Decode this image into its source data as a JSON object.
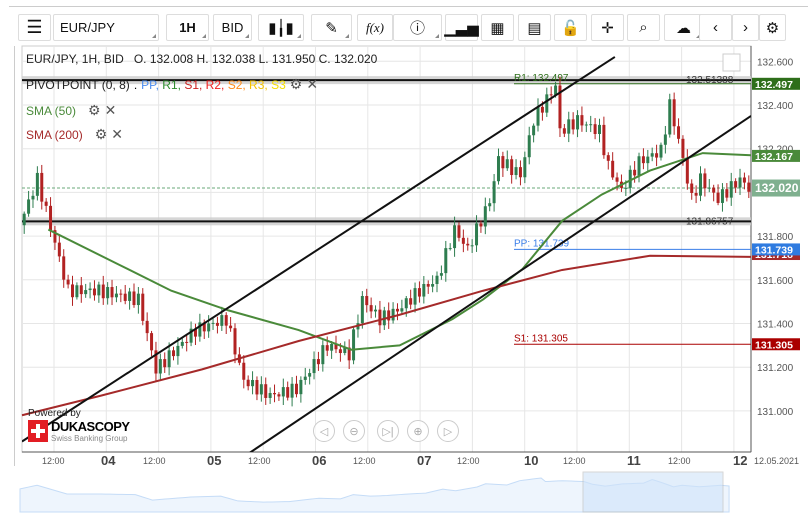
{
  "toolbar": {
    "menu_icon": "hamburger-icon",
    "instrument": "EUR/JPY",
    "timeframe": "1H",
    "side": "BID",
    "fx_label": "f(x)",
    "icons": [
      "candlestick-icon",
      "pencil-icon",
      "function-icon",
      "info-icon",
      "volume-bars-icon",
      "calendar-icon",
      "report-icon",
      "lock-open-icon",
      "crosshair-icon",
      "zoom-search-icon",
      "cloud-upload-icon",
      "chevron-left-icon",
      "chevron-right-icon",
      "gear-icon"
    ]
  },
  "header": {
    "ohlc": "EUR/JPY, 1H, BID   O. 132.008 H. 132.038 L. 131.950 C. 132.020"
  },
  "legend": {
    "pivot": "PIVOTPOINT (0, 8)",
    "pivot_sep": " . ",
    "pivot_items": [
      {
        "t": "PP",
        "c": "#4a8cf0"
      },
      {
        "t": "R1",
        "c": "#2e8b2e"
      },
      {
        "t": "S1",
        "c": "#cc2222"
      },
      {
        "t": "R2",
        "c": "#ee2222"
      },
      {
        "t": "S2",
        "c": "#ff8c1a"
      },
      {
        "t": "R3",
        "c": "#f2c200"
      },
      {
        "t": "S3",
        "c": "#f5e000"
      }
    ],
    "sma50": "SMA (50)",
    "sma200": "SMA (200)"
  },
  "levels": {
    "r1_label": "R1: 132.497",
    "r1_value": "132.497",
    "pp_label": "PP: 131.739",
    "pp_value": "131.739",
    "s1_label": "S1: 131.305",
    "s1_value": "131.305",
    "hline_top_label": "132.51388",
    "hline_bot_label": "131.86757",
    "sma50_value": "132.167",
    "sma200_value": "131.718",
    "current_value": "132.020"
  },
  "colors": {
    "up": "#2e7d4f",
    "down": "#b22222",
    "sma50": "#4a8a3a",
    "sma200": "#a52a2a",
    "r1": "#2e6e1a",
    "pp": "#3a7ee8",
    "s1": "#aa0000",
    "current": "#6aa87a"
  },
  "price_axis": [
    "132.600",
    "132.400",
    "132.200",
    "131.800",
    "131.600",
    "131.400",
    "131.200",
    "131.000"
  ],
  "time_axis": {
    "hours": [
      "12:00",
      "12:00",
      "12:00",
      "12:00",
      "12:00",
      "12:00",
      "12:00"
    ],
    "days": [
      "04",
      "05",
      "06",
      "07",
      "10",
      "11",
      "12"
    ],
    "date": "12.05.2021"
  },
  "brand": {
    "powered": "Powered by",
    "name": "DUKASCOPY",
    "sub": "Swiss Banking Group"
  },
  "chart_data": {
    "type": "candlestick",
    "ylim": [
      130.92,
      132.72
    ],
    "hours": 166,
    "price_anchors": [
      [
        0,
        131.85
      ],
      [
        4,
        132.06
      ],
      [
        11,
        131.55
      ],
      [
        18,
        131.55
      ],
      [
        27,
        131.51
      ],
      [
        31,
        131.19
      ],
      [
        40,
        131.37
      ],
      [
        47,
        131.42
      ],
      [
        51,
        131.14
      ],
      [
        57,
        131.07
      ],
      [
        63,
        131.1
      ],
      [
        70,
        131.3
      ],
      [
        75,
        131.26
      ],
      [
        78,
        131.51
      ],
      [
        82,
        131.42
      ],
      [
        86,
        131.46
      ],
      [
        91,
        131.55
      ],
      [
        95,
        131.6
      ],
      [
        99,
        131.83
      ],
      [
        102,
        131.74
      ],
      [
        107,
        131.96
      ],
      [
        109,
        132.15
      ],
      [
        114,
        132.08
      ],
      [
        117,
        132.33
      ],
      [
        122,
        132.49
      ],
      [
        123,
        132.28
      ],
      [
        127,
        132.33
      ],
      [
        132,
        132.28
      ],
      [
        134,
        132.12
      ],
      [
        137,
        132.01
      ],
      [
        141,
        132.14
      ],
      [
        146,
        132.19
      ],
      [
        148,
        132.4
      ],
      [
        150,
        132.24
      ],
      [
        153,
        131.97
      ],
      [
        155,
        132.06
      ],
      [
        159,
        131.97
      ],
      [
        164,
        132.06
      ],
      [
        166,
        132.02
      ]
    ],
    "sma50": [
      [
        6,
        131.83
      ],
      [
        22,
        131.67
      ],
      [
        34,
        131.55
      ],
      [
        47,
        131.46
      ],
      [
        63,
        131.37
      ],
      [
        75,
        131.28
      ],
      [
        86,
        131.3
      ],
      [
        98,
        131.42
      ],
      [
        105,
        131.51
      ],
      [
        114,
        131.65
      ],
      [
        123,
        131.87
      ],
      [
        132,
        131.99
      ],
      [
        143,
        132.1
      ],
      [
        155,
        132.18
      ],
      [
        166,
        132.17
      ]
    ],
    "sma200": [
      [
        0,
        130.98
      ],
      [
        18,
        131.07
      ],
      [
        41,
        131.19
      ],
      [
        63,
        131.32
      ],
      [
        86,
        131.44
      ],
      [
        105,
        131.55
      ],
      [
        123,
        131.645
      ],
      [
        143,
        131.71
      ],
      [
        166,
        131.705
      ]
    ],
    "trend_lines": [
      [
        [
          0,
          130.86
        ],
        [
          135,
          132.62
        ]
      ],
      [
        [
          49,
          130.77
        ],
        [
          166,
          132.35
        ]
      ]
    ]
  }
}
